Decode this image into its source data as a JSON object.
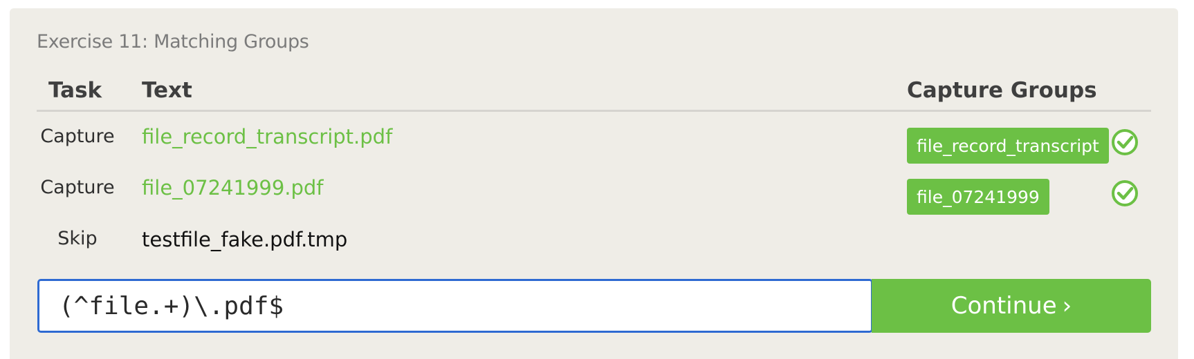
{
  "exercise": {
    "title": "Exercise 11: Matching Groups"
  },
  "table": {
    "headers": {
      "task": "Task",
      "text": "Text",
      "groups": "Capture Groups"
    },
    "rows": [
      {
        "task": "Capture",
        "text": "file_record_transcript.pdf",
        "group": "file_record_transcript",
        "status_icon": "check-circle-icon"
      },
      {
        "task": "Capture",
        "text": "file_07241999.pdf",
        "group": "file_07241999",
        "status_icon": "check-circle-icon"
      },
      {
        "task": "Skip",
        "text": "testfile_fake.pdf.tmp"
      }
    ]
  },
  "regex_input": {
    "value": "(^file.+)\\.pdf$"
  },
  "continue_button": {
    "label": "Continue",
    "icon": "chevron-right-icon"
  },
  "colors": {
    "accent": "#6cc045",
    "panel": "#efede7",
    "focus": "#2e6ad2"
  }
}
